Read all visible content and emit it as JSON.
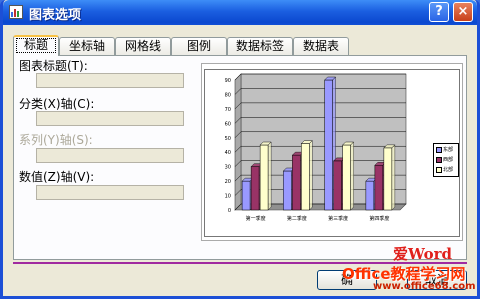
{
  "window": {
    "title": "图表选项",
    "help_label": "?",
    "close_label": "×"
  },
  "tabs": [
    {
      "label": "标题",
      "active": true
    },
    {
      "label": "坐标轴",
      "active": false
    },
    {
      "label": "网格线",
      "active": false
    },
    {
      "label": "图例",
      "active": false
    },
    {
      "label": "数据标签",
      "active": false
    },
    {
      "label": "数据表",
      "active": false
    }
  ],
  "fields": {
    "chart_title": {
      "label": "图表标题(T):",
      "value": ""
    },
    "category_x_axis": {
      "label": "分类(X)轴(C):",
      "value": ""
    },
    "series_y_axis": {
      "label": "系列(Y)轴(S):",
      "value": "",
      "disabled": true
    },
    "value_z_axis": {
      "label": "数值(Z)轴(V):",
      "value": ""
    }
  },
  "buttons": {
    "ok": "确",
    "cancel": "取消"
  },
  "watermark": {
    "line1": "爱Word",
    "line2": "Office教程学习网",
    "url": "www.office68.com"
  },
  "chart_data": {
    "type": "bar",
    "categories": [
      "第一季度",
      "第二季度",
      "第三季度",
      "第四季度"
    ],
    "series": [
      {
        "name": "东部",
        "values": [
          20,
          27,
          90,
          20
        ],
        "color": "#9999ff"
      },
      {
        "name": "西部",
        "values": [
          30,
          38,
          34,
          31
        ],
        "color": "#993366"
      },
      {
        "name": "北部",
        "values": [
          45,
          46,
          45,
          43
        ],
        "color": "#ffffcc"
      }
    ],
    "yticks": [
      "0",
      "10",
      "20",
      "30",
      "40",
      "50",
      "60",
      "70",
      "80",
      "90"
    ],
    "ylim": [
      0,
      90
    ],
    "grid": true,
    "legend_position": "right",
    "wall_color": "#c0c0c0",
    "three_d": true
  }
}
